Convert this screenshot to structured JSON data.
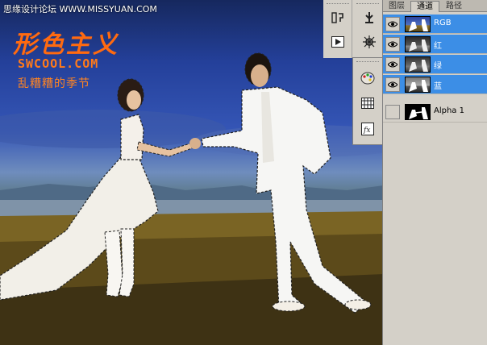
{
  "watermark": {
    "site": "思缘设计论坛 WWW.MISSYUAN.COM"
  },
  "logo": {
    "title": "形色主义",
    "sub": "SWCOOL.COM",
    "tagline": "乱糟糟的季节"
  },
  "panel": {
    "tabs": [
      {
        "label": "图层",
        "active": false
      },
      {
        "label": "通道",
        "active": true
      },
      {
        "label": "路径",
        "active": false
      }
    ],
    "channels": [
      {
        "name": "RGB",
        "visible": true,
        "selected": true,
        "thumb": "color"
      },
      {
        "name": "红",
        "visible": true,
        "selected": true,
        "thumb": "gray"
      },
      {
        "name": "绿",
        "visible": true,
        "selected": true,
        "thumb": "gray"
      },
      {
        "name": "蓝",
        "visible": true,
        "selected": true,
        "thumb": "gray"
      },
      {
        "name": "Alpha 1",
        "visible": false,
        "selected": false,
        "thumb": "mask"
      }
    ]
  },
  "tools": {
    "top_left": [
      "history-icon",
      "actions-play-icon"
    ],
    "top_right": [
      "clone-source-icon",
      "navigator-icon"
    ],
    "mid": [
      "palette-icon",
      "swatches-grid-icon",
      "styles-fx-icon"
    ]
  },
  "icons": {
    "eye": "eye-icon"
  },
  "colors": {
    "selection": "#3c8ee6",
    "logo_orange": "#ff6a10",
    "panel_bg": "#d4d0c8"
  }
}
